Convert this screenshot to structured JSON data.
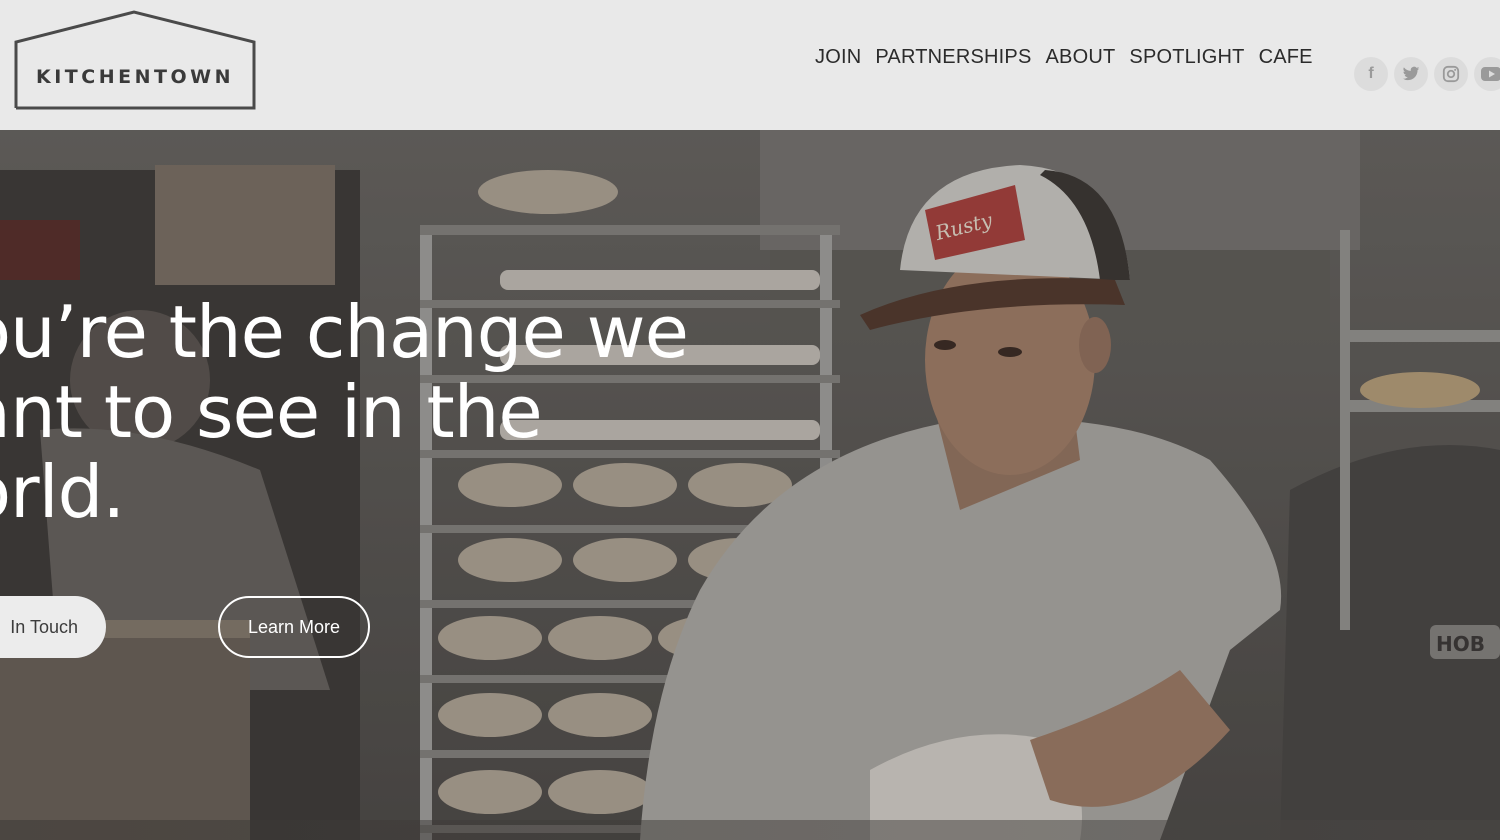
{
  "header": {
    "logo_text": "KITCHENTOWN",
    "nav": [
      {
        "label": "JOIN"
      },
      {
        "label": "PARTNERSHIPS"
      },
      {
        "label": "ABOUT"
      },
      {
        "label": "SPOTLIGHT"
      },
      {
        "label": "CAFE"
      }
    ],
    "social": [
      {
        "icon": "facebook-icon",
        "glyph": "f"
      },
      {
        "icon": "twitter-icon"
      },
      {
        "icon": "instagram-icon"
      },
      {
        "icon": "youtube-icon"
      }
    ]
  },
  "hero": {
    "headline_lines": [
      "ou’re the change we",
      "ant to see in the",
      "orld."
    ],
    "primary_button": "In Touch",
    "secondary_button": "Learn More",
    "hat_patch_text": "Rusty",
    "mixer_label": "HOB"
  },
  "colors": {
    "header_bg": "#e9e9e9",
    "nav_text": "#2b2b2b",
    "hero_text": "#ffffff"
  }
}
